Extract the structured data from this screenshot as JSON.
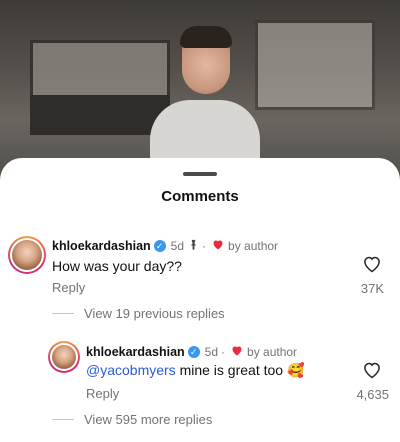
{
  "sheet": {
    "title": "Comments"
  },
  "comments": [
    {
      "username": "khloekardashian",
      "verified_mark": "✓",
      "time": "5d",
      "pinned_icon": "pin-icon",
      "dot": "·",
      "liked_icon": "heart-icon",
      "liked_by": "by author",
      "text": "How was your day??",
      "reply_label": "Reply",
      "likes": "37K",
      "view_replies": "View 19 previous replies"
    },
    {
      "username": "khloekardashian",
      "verified_mark": "✓",
      "time": "5d",
      "dot": "·",
      "liked_icon": "heart-icon",
      "liked_by": "by author",
      "mention": "@yacobmyers",
      "text": " mine is great too 🥰",
      "reply_label": "Reply",
      "likes": "4,635",
      "view_replies": "View 595 more replies"
    }
  ],
  "colors": {
    "verified": "#3897f0",
    "heart": "#ed2b3f",
    "mention": "#2a5cd8",
    "muted": "#737373"
  }
}
